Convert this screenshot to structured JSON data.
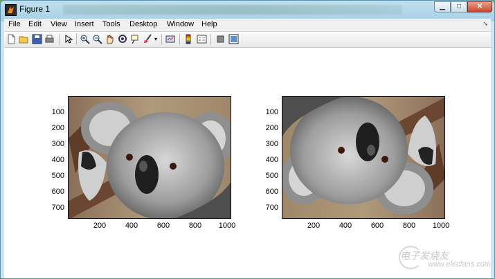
{
  "window": {
    "title": "Figure 1",
    "controls": {
      "minimize": "▁",
      "maximize": "□",
      "close": "✕"
    }
  },
  "menubar": {
    "items": [
      "File",
      "Edit",
      "View",
      "Insert",
      "Tools",
      "Desktop",
      "Window",
      "Help"
    ],
    "dock_arrow": "➘"
  },
  "toolbar": {
    "icons": [
      "new-figure-icon",
      "open-file-icon",
      "save-icon",
      "print-icon",
      "edit-plot-icon",
      "zoom-in-icon",
      "zoom-out-icon",
      "pan-icon",
      "rotate-3d-icon",
      "data-cursor-icon",
      "brush-icon",
      "brush-dropdown-icon",
      "link-plot-icon",
      "colorbar-icon",
      "legend-icon",
      "hide-plot-tools-icon",
      "show-plot-tools-icon"
    ]
  },
  "axes": [
    {
      "image": "koala photo",
      "orientation": "original",
      "y_ticks": [
        "100",
        "200",
        "300",
        "400",
        "500",
        "600",
        "700"
      ],
      "x_ticks": [
        "200",
        "400",
        "600",
        "800",
        "1000"
      ]
    },
    {
      "image": "koala photo",
      "orientation": "rotated 180°",
      "y_ticks": [
        "100",
        "200",
        "300",
        "400",
        "500",
        "600",
        "700"
      ],
      "x_ticks": [
        "200",
        "400",
        "600",
        "800",
        "1000"
      ]
    }
  ],
  "watermark": {
    "line1": "电子发烧友",
    "line2": "www.elecfans.com"
  }
}
